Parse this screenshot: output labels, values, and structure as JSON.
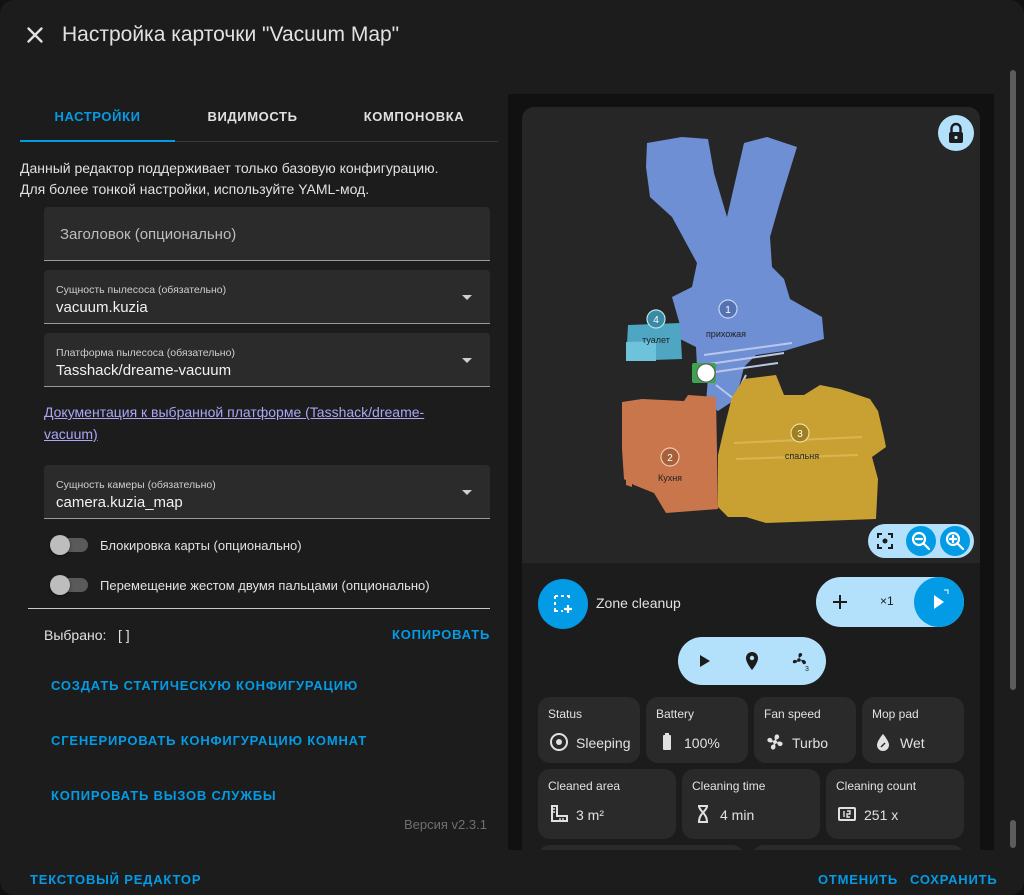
{
  "dialog": {
    "title": "Настройка карточки \"Vacuum Map\""
  },
  "tabs": [
    {
      "label": "НАСТРОЙКИ",
      "active": true
    },
    {
      "label": "ВИДИМОСТЬ",
      "active": false
    },
    {
      "label": "КОМПОНОВКА",
      "active": false
    }
  ],
  "info": {
    "line1": "Данный редактор поддерживает только базовую конфигурацию.",
    "line2": "Для более тонкой настройки, используйте YAML-мод."
  },
  "fields": {
    "title": {
      "placeholder": "Заголовок (опционально)"
    },
    "vacuum": {
      "label": "Сущность пылесоса (обязательно)",
      "value": "vacuum.kuzia"
    },
    "platform": {
      "label": "Платформа пылесоса (обязательно)",
      "value": "Tasshack/dreame-vacuum"
    },
    "doc_link": "Документация к выбранной платформе (Tasshack/dreame-vacuum)",
    "camera": {
      "label": "Сущность камеры (обязательно)",
      "value": "camera.kuzia_map"
    }
  },
  "toggles": {
    "map_lock": "Блокировка карты (опционально)",
    "two_finger": "Перемещение жестом двумя пальцами (опционально)"
  },
  "selection": {
    "label": "Выбрано:",
    "value": "[ ]",
    "copy": "КОПИРОВАТЬ"
  },
  "actions": {
    "static_config": "СОЗДАТЬ СТАТИЧЕСКУЮ КОНФИГУРАЦИЮ",
    "rooms_config": "СГЕНЕРИРОВАТЬ КОНФИГУРАЦИЮ КОМНАТ",
    "service_call": "КОПИРОВАТЬ ВЫЗОВ СЛУЖБЫ"
  },
  "version": "Версия v2.3.1",
  "footer": {
    "text_editor": "ТЕКСТОВЫЙ РЕДАКТОР",
    "cancel": "ОТМЕНИТЬ",
    "save": "СОХРАНИТЬ"
  },
  "map": {
    "rooms": [
      {
        "num": "1",
        "name": "прихожая",
        "color": "#6f8fd4"
      },
      {
        "num": "2",
        "name": "Кухня",
        "color": "#c9764c"
      },
      {
        "num": "3",
        "name": "спальня",
        "color": "#c9a132"
      },
      {
        "num": "4",
        "name": "туалет",
        "color": "#4fa6c2"
      }
    ]
  },
  "card": {
    "zone_label": "Zone cleanup",
    "repeat": "×1",
    "tiles": [
      {
        "label": "Status",
        "value": "Sleeping",
        "icon": "robot-vacuum-icon"
      },
      {
        "label": "Battery",
        "value": "100%",
        "icon": "battery-icon"
      },
      {
        "label": "Fan speed",
        "value": "Turbo",
        "icon": "fan-icon"
      },
      {
        "label": "Mop pad",
        "value": "Wet",
        "icon": "water-drop-icon"
      },
      {
        "label": "Cleaned area",
        "value": "3 m²",
        "icon": "ruler-square-icon"
      },
      {
        "label": "Cleaning time",
        "value": "4 min",
        "icon": "hourglass-icon"
      },
      {
        "label": "Cleaning count",
        "value": "251 x",
        "icon": "counter-icon"
      }
    ]
  },
  "colors": {
    "accent": "#039be5",
    "accent_light": "#b3e1fb",
    "link": "#aba6f5"
  }
}
